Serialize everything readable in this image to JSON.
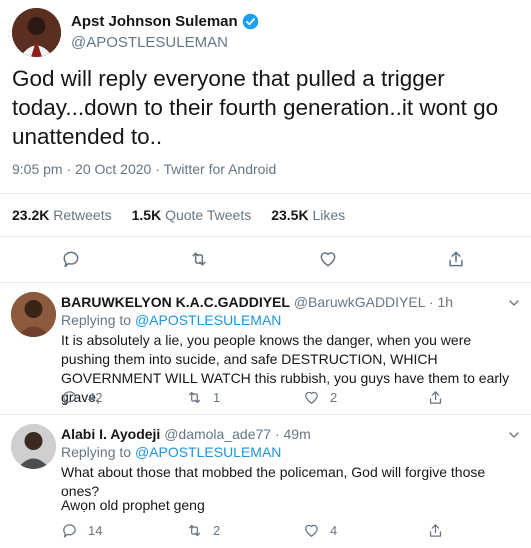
{
  "main_tweet": {
    "author_name": "Apst Johnson Suleman",
    "handle": "@APOSTLESULEMAN",
    "text": "God will reply everyone that pulled a trigger today...down to their fourth generation..it wont go unattended to..",
    "timestamp": "9:05 pm · 20 Oct 2020 · Twitter for Android",
    "stats": {
      "retweets_count": "23.2K",
      "retweets_label": "Retweets",
      "quotes_count": "1.5K",
      "quotes_label": "Quote Tweets",
      "likes_count": "23.5K",
      "likes_label": "Likes"
    }
  },
  "replies": [
    {
      "author_name": "BARUWKELYON K.A.C.GADDIYEL",
      "handle": "@BaruwkGADDIYEL",
      "time": "· 1h",
      "replying_prefix": "Replying to",
      "replying_to": "@APOSTLESULEMAN",
      "text": "It is absolutely a lie, you people knows the danger, when you were pushing them into sucide, and safe DESTRUCTION, WHICH GOVERNMENT WILL WATCH this rubbish, you guys have them to early grave,",
      "reply_count": "42",
      "retweet_count": "1",
      "like_count": "2"
    },
    {
      "author_name": "Alabi I. Ayodeji",
      "handle": "@damola_ade77",
      "time": "· 49m",
      "replying_prefix": "Replying to",
      "replying_to": "@APOSTLESULEMAN",
      "text": "What about those that mobbed the policeman, God will forgive those ones?",
      "text2": "Awọn old prophet geng",
      "reply_count": "14",
      "retweet_count": "2",
      "like_count": "4"
    }
  ],
  "colors": {
    "text": "#14171a",
    "secondary": "#657786",
    "accent": "#1b95e0",
    "divider": "#e6ecf0"
  },
  "icons": [
    "verified-badge-icon",
    "reply-icon",
    "retweet-icon",
    "like-icon",
    "share-icon",
    "more-icon"
  ]
}
